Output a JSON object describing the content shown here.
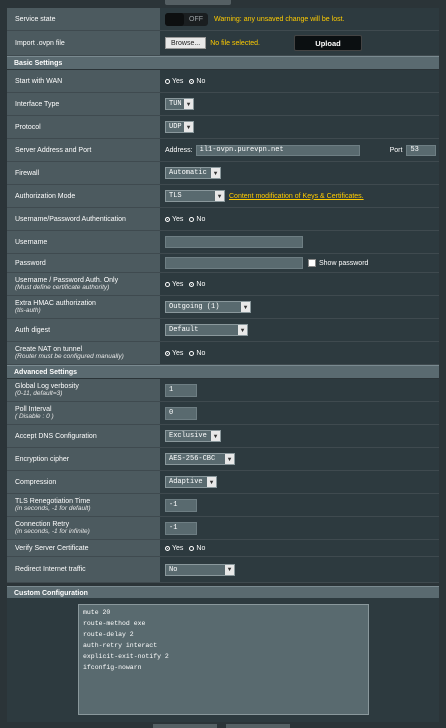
{
  "service_state": {
    "label": "Service state",
    "toggle_text": "OFF",
    "warning": "Warning: any unsaved change will be lost."
  },
  "import": {
    "label": "Import .ovpn file",
    "browse_label": "Browse...",
    "file_status": "No file selected.",
    "upload_label": "Upload"
  },
  "basic": {
    "title": "Basic Settings",
    "start_with_wan": {
      "label": "Start with WAN",
      "yes": "Yes",
      "no": "No",
      "selected": "no"
    },
    "interface_type": {
      "label": "Interface Type",
      "value": "TUN"
    },
    "protocol": {
      "label": "Protocol",
      "value": "UDP"
    },
    "server_address": {
      "label": "Server Address and Port",
      "address_label": "Address:",
      "address_value": "il1-ovpn.purevpn.net",
      "port_label": "Port",
      "port_value": "53"
    },
    "firewall": {
      "label": "Firewall",
      "value": "Automatic"
    },
    "auth_mode": {
      "label": "Authorization Mode",
      "value": "TLS",
      "link": "Content modification of Keys & Certificates."
    },
    "userpass_auth": {
      "label": "Username/Password Authentication",
      "yes": "Yes",
      "no": "No",
      "selected": "yes"
    },
    "username": {
      "label": "Username",
      "value": ""
    },
    "password": {
      "label": "Password",
      "value": "",
      "show_label": "Show password"
    },
    "userpass_only": {
      "label": "Username / Password Auth. Only",
      "sub": "(Must define certificate authority)",
      "yes": "Yes",
      "no": "No",
      "selected": "no"
    },
    "hmac": {
      "label": "Extra HMAC authorization",
      "sub": "(tls-auth)",
      "value": "Outgoing (1)"
    },
    "auth_digest": {
      "label": "Auth digest",
      "value": "Default"
    },
    "create_nat": {
      "label": "Create NAT on tunnel",
      "sub": "(Router must be configured manually)",
      "yes": "Yes",
      "no": "No",
      "selected": "yes"
    }
  },
  "advanced": {
    "title": "Advanced Settings",
    "log_verbosity": {
      "label": "Global Log verbosity",
      "sub": "(0-11, default=3)",
      "value": "1"
    },
    "poll_interval": {
      "label": "Poll Interval",
      "sub": "( Disable : 0 )",
      "value": "0"
    },
    "accept_dns": {
      "label": "Accept DNS Configuration",
      "value": "Exclusive"
    },
    "cipher": {
      "label": "Encryption cipher",
      "value": "AES-256-CBC"
    },
    "compression": {
      "label": "Compression",
      "value": "Adaptive"
    },
    "tls_reneg": {
      "label": "TLS Renegotiation Time",
      "sub": "(in seconds, -1 for default)",
      "value": "-1"
    },
    "conn_retry": {
      "label": "Connection Retry",
      "sub": "(in seconds, -1 for infinite)",
      "value": "-1"
    },
    "verify_cert": {
      "label": "Verify Server Certificate",
      "yes": "Yes",
      "no": "No",
      "selected": "yes"
    },
    "redirect": {
      "label": "Redirect Internet traffic",
      "value": "No"
    }
  },
  "custom": {
    "title": "Custom Configuration",
    "lines": [
      "mute 20",
      "route-method exe",
      "route-delay 2",
      "auth-retry interact",
      "explicit-exit-notify 2",
      "ifconfig-nowarn"
    ]
  },
  "colors": {
    "accent": "#ffcc00",
    "section": "#5a6a70",
    "label_bg": "#4c5a5f"
  }
}
